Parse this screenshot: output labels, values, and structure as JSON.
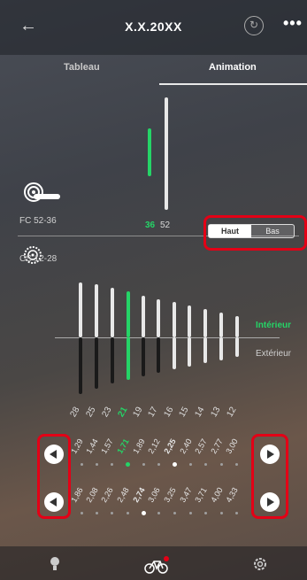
{
  "header": {
    "back_icon": "back-arrow-icon",
    "title": "X.X.20XX",
    "history_icon": "history-icon",
    "more_icon": "more-icon",
    "more_label": "•••"
  },
  "tabs": [
    {
      "label": "Tableau",
      "active": false
    },
    {
      "label": "Animation",
      "active": true
    }
  ],
  "crankset": {
    "label": "FC 52-36",
    "icon": "crankset-icon",
    "rings": [
      {
        "label": "36",
        "active": true
      },
      {
        "label": "52",
        "active": false
      }
    ]
  },
  "cassette": {
    "label": "CS 12-28",
    "icon": "cassette-icon"
  },
  "toggle": {
    "options": [
      "Haut",
      "Bas"
    ],
    "selected": "Haut"
  },
  "sides": {
    "inner": "Intérieur",
    "outer": "Extérieur"
  },
  "sprockets": [
    "28",
    "25",
    "23",
    "21",
    "19",
    "17",
    "16",
    "15",
    "14",
    "13",
    "12"
  ],
  "active_sprocket": "21",
  "ratio_rows": [
    {
      "values": [
        "1,29",
        "1,44",
        "1,57",
        "1,71",
        "1,89",
        "2,12",
        "2,25",
        "2,40",
        "2,57",
        "2,77",
        "3,00"
      ],
      "active": "1,71",
      "bold": "2,25"
    },
    {
      "values": [
        "1,86",
        "2,08",
        "2,26",
        "2,48",
        "2,74",
        "3,06",
        "3,25",
        "3,47",
        "3,71",
        "4,00",
        "4,33"
      ],
      "bold": "2,74"
    }
  ],
  "controls": {
    "left_icon": "arrow-left-circle-icon",
    "right_icon": "arrow-right-circle-icon"
  },
  "footer": {
    "items": [
      {
        "icon": "bulb-icon"
      },
      {
        "icon": "bike-icon",
        "active": true
      },
      {
        "icon": "gear-icon"
      }
    ]
  },
  "colors": {
    "accent": "#25d467",
    "highlight": "#e30016"
  }
}
